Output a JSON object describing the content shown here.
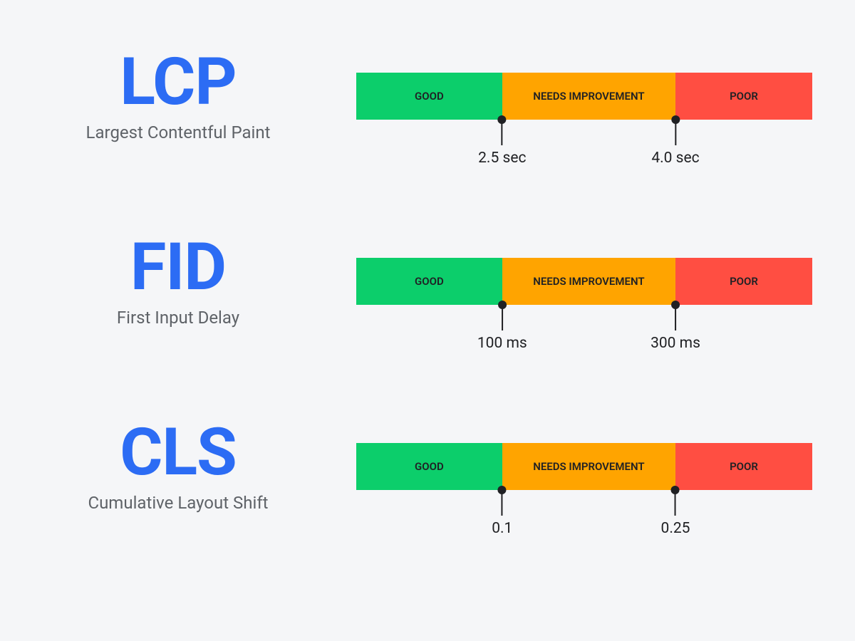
{
  "metrics": [
    {
      "abbr": "LCP",
      "full": "Largest Contentful Paint",
      "segments": {
        "good": "GOOD",
        "mid": "NEEDS IMPROVEMENT",
        "poor": "POOR"
      },
      "thresholds": {
        "first": "2.5 sec",
        "second": "4.0 sec"
      }
    },
    {
      "abbr": "FID",
      "full": "First Input Delay",
      "segments": {
        "good": "GOOD",
        "mid": "NEEDS IMPROVEMENT",
        "poor": "POOR"
      },
      "thresholds": {
        "first": "100 ms",
        "second": "300 ms"
      }
    },
    {
      "abbr": "CLS",
      "full": "Cumulative Layout Shift",
      "segments": {
        "good": "GOOD",
        "mid": "NEEDS IMPROVEMENT",
        "poor": "POOR"
      },
      "thresholds": {
        "first": "0.1",
        "second": "0.25"
      }
    }
  ],
  "colors": {
    "accent": "#2c6cf4",
    "good": "#0cce6b",
    "mid": "#ffa400",
    "poor": "#ff4e42"
  }
}
